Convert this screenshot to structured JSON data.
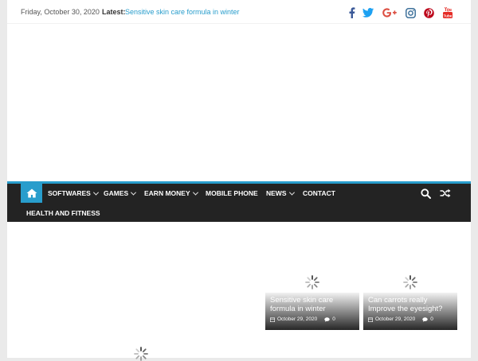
{
  "topbar": {
    "date": "Friday, October 30, 2020",
    "latest_label": "Latest:",
    "latest_link": "Sensitive skin care formula in winter"
  },
  "social_icons": [
    "facebook-icon",
    "twitter-icon",
    "google-plus-icon",
    "instagram-icon",
    "pinterest-icon",
    "youtube-icon"
  ],
  "nav": {
    "home_icon": "home-icon",
    "items": [
      {
        "label": "SOFTWARES",
        "dropdown": true
      },
      {
        "label": "GAMES",
        "dropdown": true
      },
      {
        "label": "EARN MONEY",
        "dropdown": true
      },
      {
        "label": "MOBILE PHONE",
        "dropdown": false
      },
      {
        "label": "NEWS",
        "dropdown": true
      },
      {
        "label": "CONTACT",
        "dropdown": false
      },
      {
        "label": "HEALTH AND FITNESS",
        "dropdown": false
      }
    ],
    "search_icon": "search-icon",
    "random_icon": "shuffle-icon"
  },
  "featured": [
    {
      "title": "Sensitive skin care formula in winter",
      "date": "October 29, 2020",
      "comments": "0"
    },
    {
      "title": "Can carrots really Improve the eyesight?",
      "date": "October 29, 2020",
      "comments": "0"
    }
  ],
  "colors": {
    "accent": "#289dcc",
    "nav_bg": "#232323",
    "facebook": "#3b5998",
    "twitter": "#1da1f2",
    "google_plus": "#dc4e41",
    "instagram": "#3f729b",
    "pinterest": "#bd081c",
    "youtube": "#e52d27"
  }
}
